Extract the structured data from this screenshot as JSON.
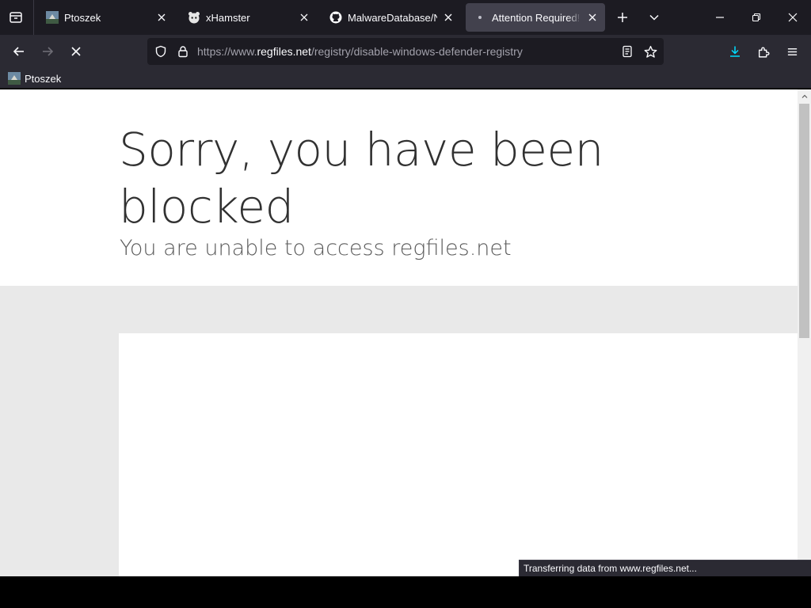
{
  "tabs": [
    {
      "label": "Ptoszek",
      "active": false,
      "favicon": "bird-photo-favicon"
    },
    {
      "label": "xHamster",
      "active": false,
      "favicon": "xhamster-favicon"
    },
    {
      "label": "MalwareDatabase/NoE",
      "active": false,
      "favicon": "github-favicon"
    },
    {
      "label": "Attention Required! | Cl",
      "active": true,
      "favicon": "loading-dot"
    }
  ],
  "nav": {
    "url_prefix": "https://www.",
    "url_host": "regfiles.net",
    "url_path": "/registry/disable-windows-defender-registry"
  },
  "bookmarks": [
    {
      "label": "Ptoszek",
      "favicon": "bird-photo-favicon"
    }
  ],
  "page": {
    "heading": "Sorry, you have been blocked",
    "subheading": "You are unable to access regfiles.net"
  },
  "status": {
    "text": "Transferring data from www.regfiles.net..."
  },
  "colors": {
    "tab_strip": "#1c1b22",
    "toolbar": "#2b2a33",
    "active_tab": "#42414d",
    "download_accent": "#00ddff",
    "page_band": "#e9e9e9"
  },
  "icons": [
    "tab-list-icon",
    "close-icon",
    "plus-icon",
    "chevron-down-icon",
    "minimize-icon",
    "restore-icon",
    "window-close-icon",
    "back-arrow-icon",
    "forward-arrow-icon",
    "stop-loading-icon",
    "shield-icon",
    "lock-icon",
    "reader-view-icon",
    "star-icon",
    "download-icon",
    "extensions-icon",
    "menu-icon"
  ]
}
